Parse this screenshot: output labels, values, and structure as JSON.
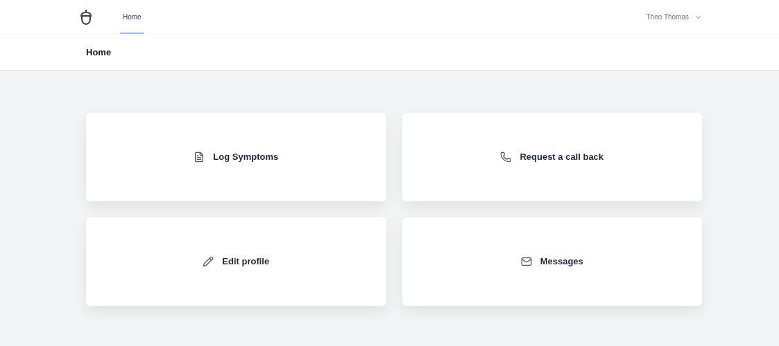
{
  "nav": {
    "tabs": [
      {
        "label": "Home",
        "selected": true
      }
    ],
    "user": "Theo Thomas"
  },
  "page_title": "Home",
  "cards": [
    {
      "kind": "document",
      "label": "Log Symptoms"
    },
    {
      "kind": "phone",
      "label": "Request a call back"
    },
    {
      "kind": "pencil",
      "label": "Edit profile"
    },
    {
      "kind": "mail",
      "label": "Messages"
    }
  ]
}
